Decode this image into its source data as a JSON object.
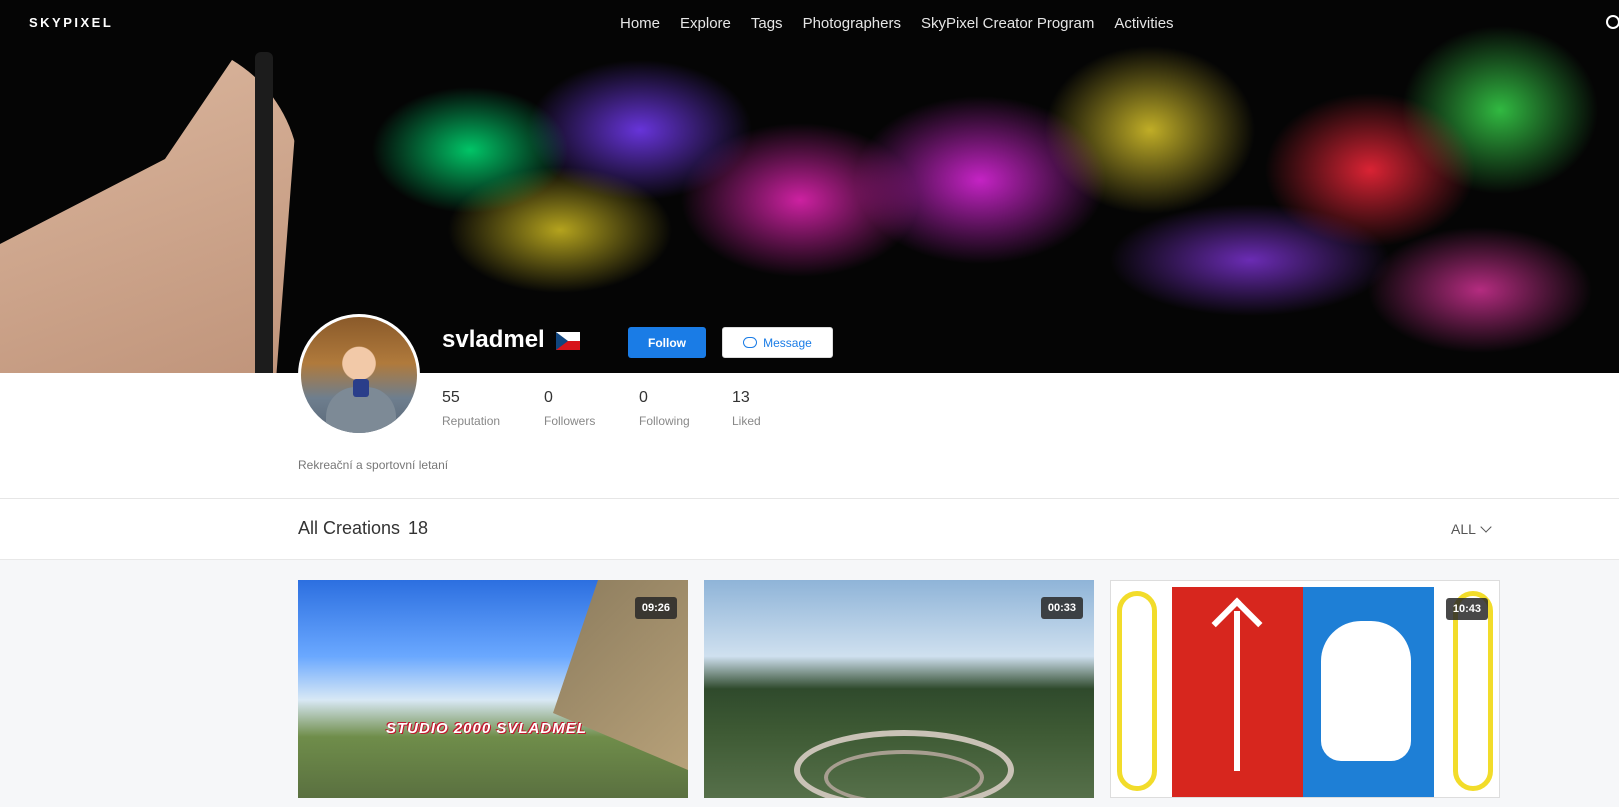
{
  "nav": {
    "logo": "SKYPIXEL",
    "links": [
      "Home",
      "Explore",
      "Tags",
      "Photographers",
      "SkyPixel Creator Program",
      "Activities"
    ]
  },
  "profile": {
    "username": "svladmel",
    "follow_label": "Follow",
    "message_label": "Message",
    "stats": [
      {
        "value": "55",
        "label": "Reputation"
      },
      {
        "value": "0",
        "label": "Followers"
      },
      {
        "value": "0",
        "label": "Following"
      },
      {
        "value": "13",
        "label": "Liked"
      }
    ],
    "bio": "Rekreační a sportovní letaní"
  },
  "creations": {
    "title": "All Creations",
    "count": "18",
    "filter": "ALL",
    "items": [
      {
        "duration": "09:26",
        "watermark": "STUDIO 2000   SVLADMEL"
      },
      {
        "duration": "00:33"
      },
      {
        "duration": "10:43"
      }
    ]
  },
  "colors": {
    "accent": "#1a7ce6",
    "page_bg": "#f6f7f9"
  }
}
